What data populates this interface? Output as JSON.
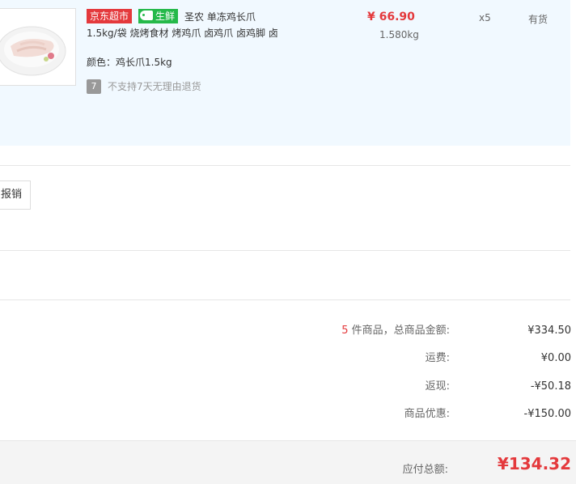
{
  "product": {
    "badge_jd": "京东超市",
    "badge_fresh": "生鲜",
    "title_line1": "圣农 单冻鸡长爪",
    "title_line2": "1.5kg/袋 烧烤食材 烤鸡爪 卤鸡爪 卤鸡脚 卤",
    "spec_label": "颜色：",
    "spec_value": "鸡长爪1.5kg",
    "return_icon": "7",
    "return_text": "不支持7天无理由退货",
    "price": "¥ 66.90",
    "weight": "1.580kg",
    "quantity": "x5",
    "stock": "有货"
  },
  "invoice": {
    "label": "报销"
  },
  "summary": {
    "count": "5",
    "items_label": " 件商品，总商品金额:",
    "items_value": "¥334.50",
    "shipping_label": "运费:",
    "shipping_value": "¥0.00",
    "cashback_label": "返现:",
    "cashback_value": "-¥50.18",
    "discount_label": "商品优惠:",
    "discount_value": "-¥150.00"
  },
  "total": {
    "label": "应付总额:",
    "value": "¥134.32"
  },
  "colors": {
    "accent": "#e4393c",
    "fresh": "#25b94a",
    "panel": "#f1f9ff"
  }
}
